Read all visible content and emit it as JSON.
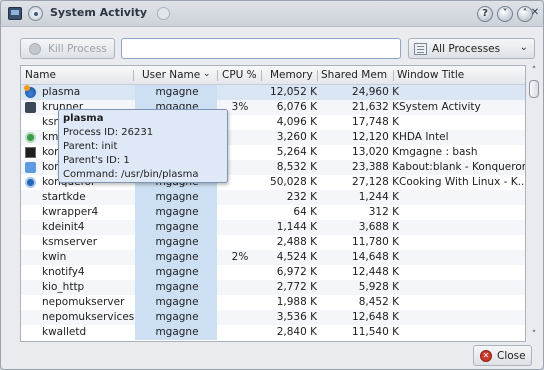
{
  "window": {
    "title": "System Activity",
    "help_label": "?",
    "minimize_label": "˅",
    "maximize_label": "˄",
    "close_label": "✕"
  },
  "toolbar": {
    "kill_label": "Kill Process",
    "search_value": "",
    "search_placeholder": "",
    "filter_selected": "All Processes",
    "filter_arrow": "⌄"
  },
  "table": {
    "columns": {
      "name": "Name",
      "user": "User Name",
      "user_sort": "⌄",
      "cpu": "CPU %",
      "memory": "Memory",
      "shared": "Shared Mem",
      "window": "Window Title"
    },
    "rows": [
      {
        "name": "plasma",
        "user": "mgagne",
        "cpu": "",
        "memory": "12,052 K",
        "shared": "24,960 K",
        "title": "",
        "icon": "plasma-icon"
      },
      {
        "name": "krunner",
        "user": "mgagne",
        "cpu": "3%",
        "memory": "6,076 K",
        "shared": "21,632 K",
        "title": "System Activity",
        "icon": "krunner-icon"
      },
      {
        "name": "ksnapshot",
        "user": "mgagne",
        "cpu": "",
        "memory": "4,096 K",
        "shared": "17,748 K",
        "title": "",
        "icon": ""
      },
      {
        "name": "kmix",
        "user": "mgagne",
        "cpu": "",
        "memory": "3,260 K",
        "shared": "12,120 K",
        "title": "HDA Intel",
        "icon": "kmix-icon"
      },
      {
        "name": "konsole",
        "user": "mgagne",
        "cpu": "",
        "memory": "5,264 K",
        "shared": "13,020 K",
        "title": "mgagne : bash",
        "icon": "konsole-icon"
      },
      {
        "name": "konqueror",
        "user": "mgagne",
        "cpu": "",
        "memory": "8,532 K",
        "shared": "23,388 K",
        "title": "about:blank - Konqueror",
        "icon": "konqueror-folder-icon"
      },
      {
        "name": "konqueror",
        "user": "mgagne",
        "cpu": "",
        "memory": "50,028 K",
        "shared": "27,128 K",
        "title": "Cooking With Linux - K...",
        "icon": "konqueror-globe-icon"
      },
      {
        "name": "startkde",
        "user": "mgagne",
        "cpu": "",
        "memory": "232 K",
        "shared": "1,244 K",
        "title": "",
        "icon": ""
      },
      {
        "name": "kwrapper4",
        "user": "mgagne",
        "cpu": "",
        "memory": "64 K",
        "shared": "312 K",
        "title": "",
        "icon": ""
      },
      {
        "name": "kdeinit4",
        "user": "mgagne",
        "cpu": "",
        "memory": "1,144 K",
        "shared": "3,688 K",
        "title": "",
        "icon": ""
      },
      {
        "name": "ksmserver",
        "user": "mgagne",
        "cpu": "",
        "memory": "2,488 K",
        "shared": "11,780 K",
        "title": "",
        "icon": ""
      },
      {
        "name": "kwin",
        "user": "mgagne",
        "cpu": "2%",
        "memory": "4,524 K",
        "shared": "14,648 K",
        "title": "",
        "icon": ""
      },
      {
        "name": "knotify4",
        "user": "mgagne",
        "cpu": "",
        "memory": "6,972 K",
        "shared": "12,448 K",
        "title": "",
        "icon": ""
      },
      {
        "name": "kio_http",
        "user": "mgagne",
        "cpu": "",
        "memory": "2,772 K",
        "shared": "5,928 K",
        "title": "",
        "icon": ""
      },
      {
        "name": "nepomukserver",
        "user": "mgagne",
        "cpu": "",
        "memory": "1,988 K",
        "shared": "8,452 K",
        "title": "",
        "icon": ""
      },
      {
        "name": "nepomukservices",
        "user": "mgagne",
        "cpu": "",
        "memory": "3,536 K",
        "shared": "12,648 K",
        "title": "",
        "icon": ""
      },
      {
        "name": "kwalletd",
        "user": "mgagne",
        "cpu": "",
        "memory": "2,840 K",
        "shared": "11,540 K",
        "title": "",
        "icon": ""
      }
    ]
  },
  "tooltip": {
    "title": "plasma",
    "pid": "Process ID: 26231",
    "parent": "Parent: init",
    "parent_id": "Parent's ID: 1",
    "command": "Command: /usr/bin/plasma"
  },
  "scrollbar": {
    "up": "˄",
    "down": "˅"
  },
  "footer": {
    "close_label": "Close"
  }
}
